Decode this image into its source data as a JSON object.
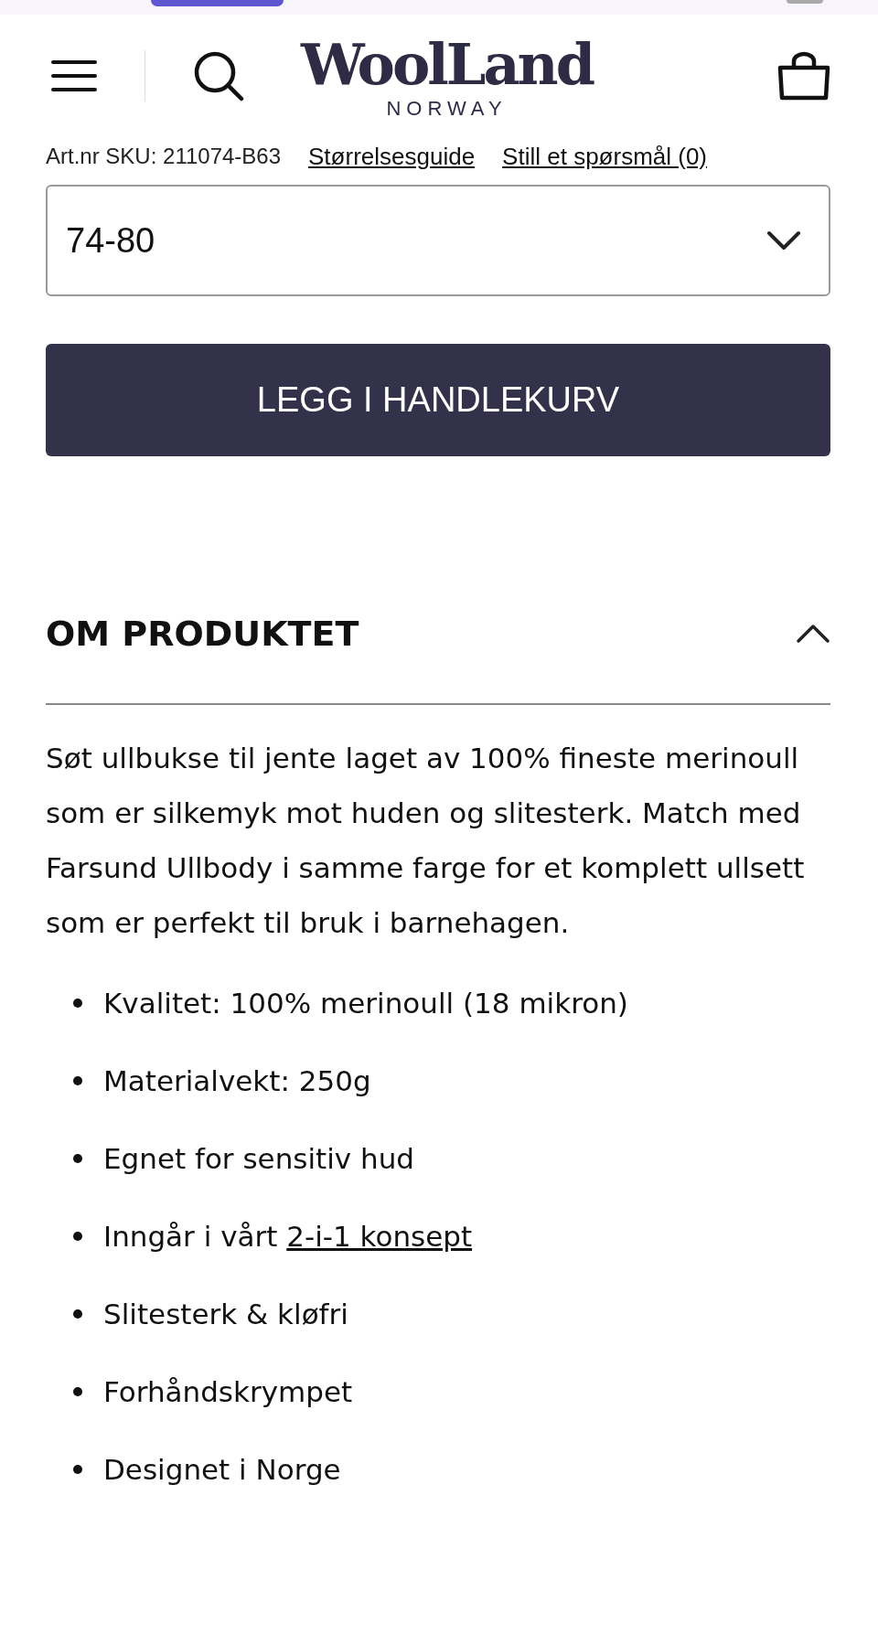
{
  "header": {
    "logo": "WoolLand",
    "logo_sub": "NORWAY"
  },
  "product_meta": {
    "sku": "Art.nr SKU: 211074-B63",
    "links": [
      "Størrelsesguide",
      "Still et spørsmål (0)"
    ]
  },
  "size_select": {
    "value": "74-80"
  },
  "add_to_cart": "LEGG I HANDLEKURV",
  "section": {
    "title": "OM PRODUKTET",
    "expanded": true,
    "description": "Søt ullbukse til jente laget av 100% fineste merinoull som er silkemyk mot huden og slitesterk. Match med Farsund Ullbody i samme farge for et komplett ullsett som er perfekt til bruk i barnehagen.",
    "features": [
      {
        "text": "Kvalitet: 100% merinoull (18 mikron)"
      },
      {
        "text": "Materialvekt: 250g"
      },
      {
        "text": "Egnet for sensitiv hud"
      },
      {
        "text": "Inngår i vårt ",
        "link": "2-i-1 konsept"
      },
      {
        "text": "Slitesterk & kløfri"
      },
      {
        "text": "Forhåndskrympet"
      },
      {
        "text": "Designet i Norge"
      }
    ]
  }
}
